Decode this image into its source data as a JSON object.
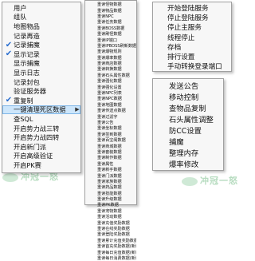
{
  "watermark_text": "冲冠一怒",
  "menu_main": {
    "items": [
      {
        "label": "用户",
        "checked": false,
        "submenu": false
      },
      {
        "label": "组队",
        "checked": false,
        "submenu": false
      },
      {
        "label": "地图物品",
        "checked": false,
        "submenu": false
      },
      {
        "label": "记录再造",
        "checked": false,
        "submenu": false
      },
      {
        "label": "记录捕魔",
        "checked": true,
        "submenu": false
      },
      {
        "label": "显示记录",
        "checked": true,
        "submenu": false
      },
      {
        "label": "显示捕魔",
        "checked": false,
        "submenu": false
      },
      {
        "label": "显示日志",
        "checked": false,
        "submenu": false
      },
      {
        "label": "记录封包",
        "checked": false,
        "submenu": false
      },
      {
        "label": "验证服务器",
        "checked": false,
        "submenu": false
      },
      {
        "label": "重复制",
        "checked": true,
        "submenu": false
      },
      {
        "label": "一键清理死区数据",
        "checked": false,
        "submenu": true
      },
      {
        "label": "查SQL",
        "checked": false,
        "submenu": false
      },
      {
        "label": "开启势力战三转",
        "checked": false,
        "submenu": false
      },
      {
        "label": "开启势力战四转",
        "checked": false,
        "submenu": false
      },
      {
        "label": "开启新门派",
        "checked": false,
        "submenu": false
      },
      {
        "label": "开启高级验证",
        "checked": false,
        "submenu": false
      },
      {
        "label": "开启PK赛",
        "checked": false,
        "submenu": false
      }
    ]
  },
  "menu_sub": {
    "items": [
      "重读怪物数据",
      "重读物品数据",
      "重读NPC",
      "重读任务数据",
      "重读BOSS数据",
      "重读刷怪数据",
      "重读IP端口",
      "重读IPBOSS刷新数据",
      "重读爆物规则",
      "重读爆率数据",
      "重读商店数据",
      "重读转换数据",
      "重读石头属性数据",
      "重读强化数据",
      "重读强化设置",
      "重读NPC列表",
      "重读NPC数据",
      "重读地图数据",
      "重读传送点数据",
      "重读过滤字",
      "重读公告",
      "重读坐标数据",
      "重读签到数据",
      "重读百宝阁数据",
      "重读商城数据",
      "重读套装数据",
      "重读制作数据",
      "重读属性",
      "重读新手数据",
      "重读门派数据",
      "重读家族数据",
      "重读药品数据",
      "重读技能数据",
      "重读升级数据",
      "重读PK数据",
      "重读宠物数据",
      "重读活动数据",
      "重读充值奖励数据",
      "重读在线奖励数据",
      "重读登陆奖励数据",
      "重读累计充值奖励数据(新版)",
      "重读首充奖励数据(新版)",
      "重读每日充值数据(新版)",
      "重读每日消费数据(新版)"
    ]
  },
  "menu_server": {
    "items": [
      "开始登陆服务",
      "停止登陆服务",
      "停止主服务",
      "线程停止",
      "存档",
      "排行设置",
      "手动转换登录端口"
    ]
  },
  "menu_tools": {
    "items": [
      "发送公告",
      "移动控制",
      "查物品复制",
      "石头属性调整",
      "防CC设置",
      "捕魔",
      "整理内存",
      "爆率修改"
    ]
  }
}
